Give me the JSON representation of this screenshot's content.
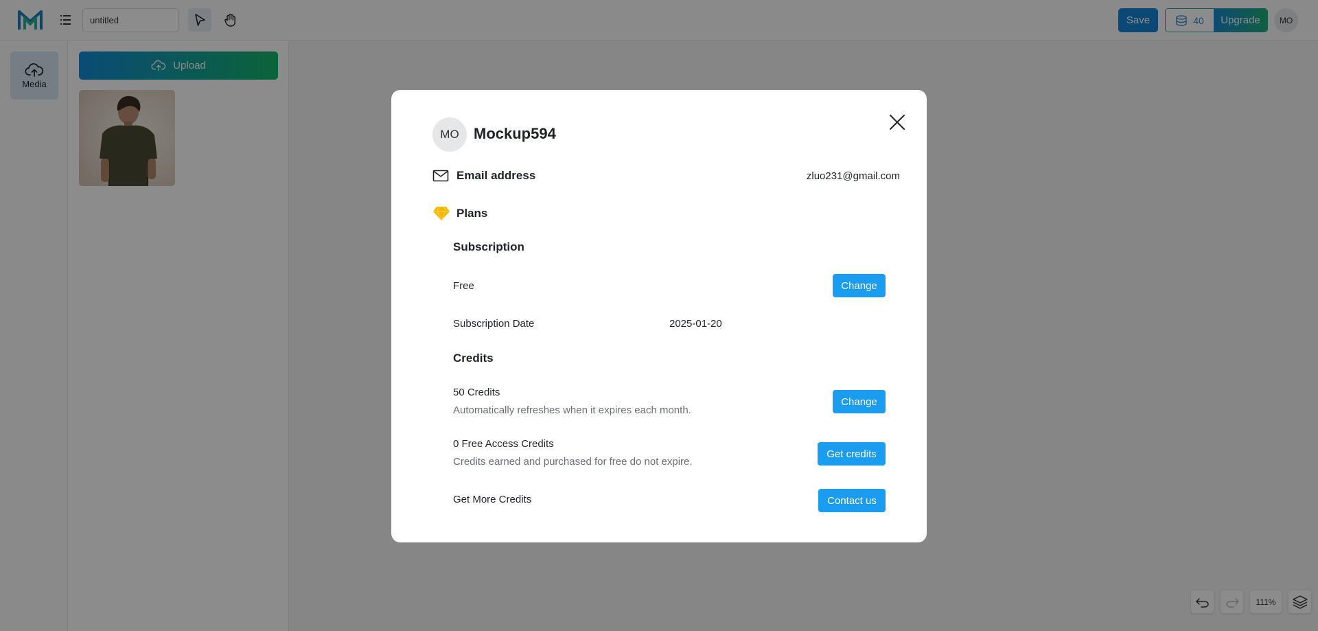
{
  "topbar": {
    "logo_icon": "m-logo-icon",
    "menu_icon": "hamburger-menu-icon",
    "document_title": "untitled",
    "tools": [
      {
        "name": "select-tool",
        "icon": "cursor-arrow-icon",
        "active": true
      },
      {
        "name": "hand-tool",
        "icon": "hand-icon",
        "active": false
      }
    ],
    "save_label": "Save",
    "credits_count": "40",
    "credits_icon": "database-icon",
    "upgrade_label": "Upgrade",
    "avatar_initials": "MO"
  },
  "sidebar": {
    "items": [
      {
        "label": "Media",
        "icon": "cloud-upload-icon",
        "active": true
      }
    ]
  },
  "media_panel": {
    "upload_label": "Upload",
    "upload_icon": "cloud-upload-icon",
    "thumbnails": [
      {
        "alt": "person in olive t-shirt"
      }
    ]
  },
  "canvas_tools": {
    "undo_icon": "undo-icon",
    "redo_icon": "redo-icon",
    "zoom": "111%",
    "layers_icon": "layers-icon"
  },
  "modal": {
    "avatar_initials": "MO",
    "username": "Mockup594",
    "email_label": "Email address",
    "email_value": "zluo231@gmail.com",
    "plans_label": "Plans",
    "subscription_heading": "Subscription",
    "plan_name": "Free",
    "plan_change_label": "Change",
    "subscription_date_label": "Subscription Date",
    "subscription_date_value": "2025-01-20",
    "credits_heading": "Credits",
    "monthly_credits": "50 Credits",
    "monthly_credits_desc": "Automatically refreshes when it expires each month.",
    "monthly_change_label": "Change",
    "free_credits": "0 Free Access Credits",
    "free_credits_desc": "Credits earned and purchased for free do not expire.",
    "get_credits_label": "Get credits",
    "more_credits_label": "Get More Credits",
    "contact_label": "Contact us"
  },
  "colors": {
    "accent": "#1a9cf0",
    "save": "#1484d6",
    "upgrade_gradient_start": "#1a88d0",
    "upgrade_gradient_end": "#1fae7a",
    "plans_icon": "#f5b800"
  }
}
